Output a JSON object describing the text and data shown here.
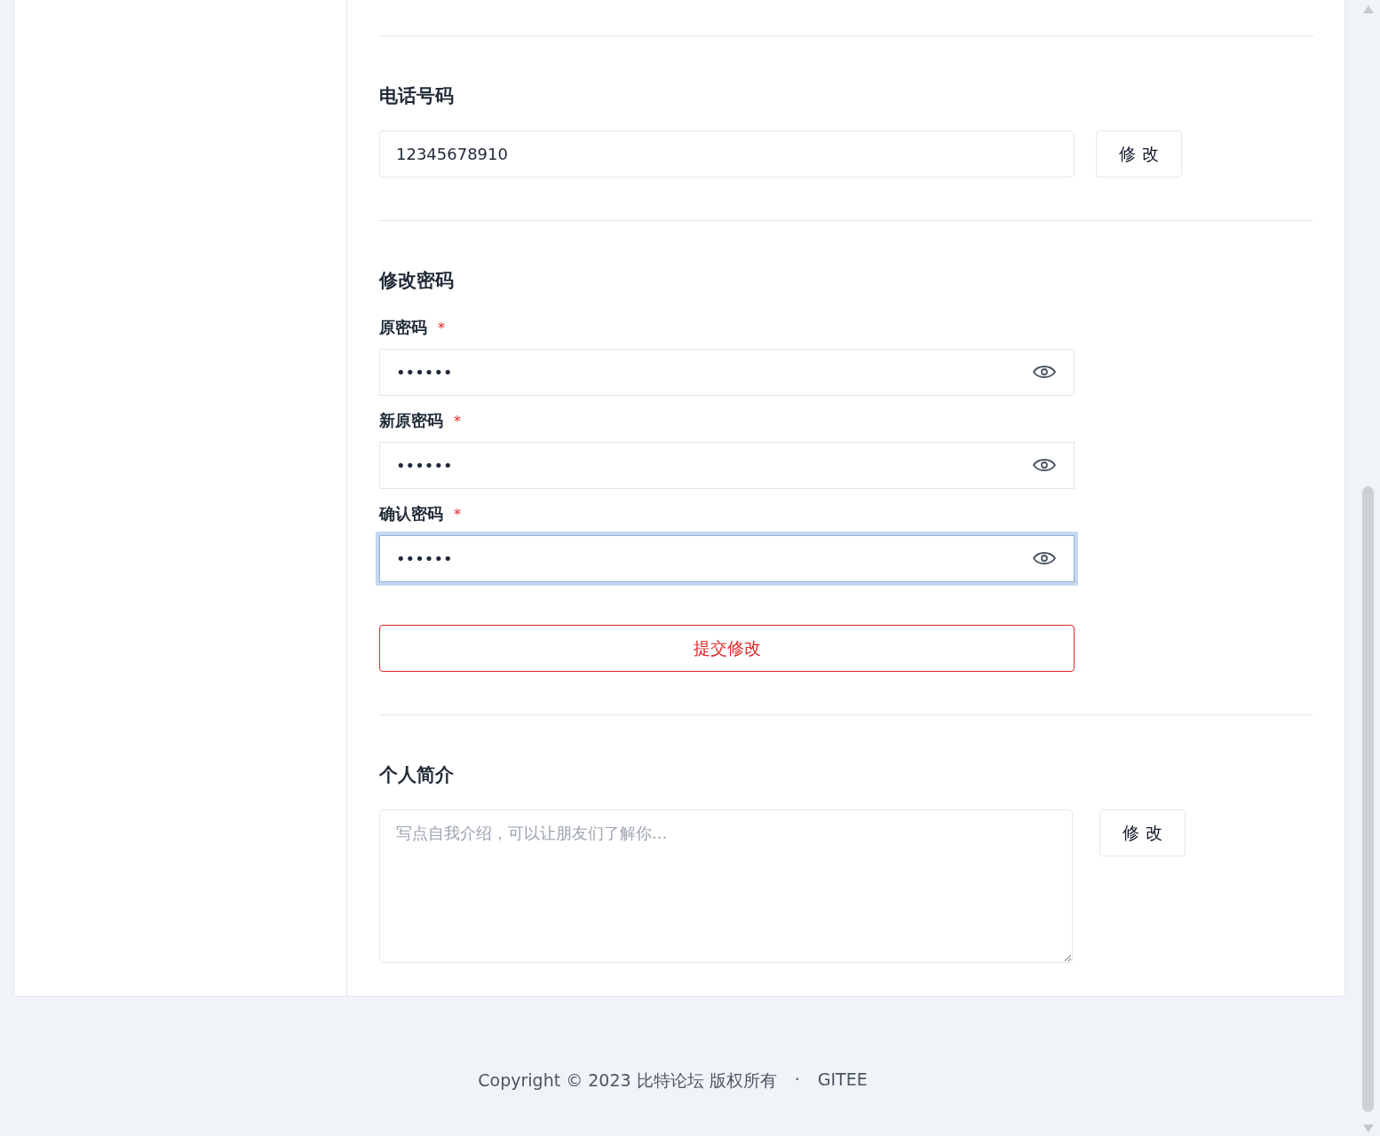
{
  "phone": {
    "heading": "电话号码",
    "value": "12345678910",
    "button": "修 改"
  },
  "password": {
    "heading": "修改密码",
    "fields": [
      {
        "label": "原密码",
        "required_mark": "*",
        "value": "••••••",
        "focused": false
      },
      {
        "label": "新原密码",
        "required_mark": "*",
        "value": "••••••",
        "focused": false
      },
      {
        "label": "确认密码",
        "required_mark": "*",
        "value": "••••••",
        "focused": true
      }
    ],
    "submit": "提交修改"
  },
  "bio": {
    "heading": "个人简介",
    "placeholder": "写点自我介绍，可以让朋友们了解你...",
    "button": "修 改"
  },
  "footer": {
    "copyright": "Copyright © 2023 比特论坛 版权所有",
    "separator": "·",
    "link": "GITEE"
  }
}
